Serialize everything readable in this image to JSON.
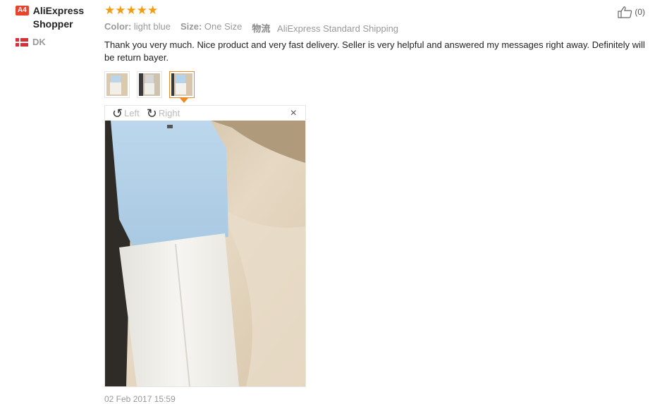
{
  "reviewer": {
    "badge": "A4",
    "name": "AliExpress Shopper",
    "country": "DK"
  },
  "rating": {
    "stars": 5,
    "display": "★★★★★"
  },
  "attributes": {
    "color_label": "Color:",
    "color_value": "light blue",
    "size_label": "Size:",
    "size_value": "One Size",
    "shipping_icon": "物流",
    "shipping_value": "AliExpress Standard Shipping"
  },
  "feedback": "Thank you very much. Nice product and very fast delivery. Seller is very helpful and answered my messages right away. Definitely will be return bayer.",
  "thumbnails": [
    {
      "name": "thumb-1",
      "active": false
    },
    {
      "name": "thumb-2",
      "active": false
    },
    {
      "name": "thumb-3",
      "active": true
    }
  ],
  "viewer": {
    "rotate_left_label": "Left",
    "rotate_right_label": "Right",
    "close_label": "×"
  },
  "like": {
    "count_text": "(0)"
  },
  "timestamp": "02 Feb 2017 15:59",
  "colors": {
    "accent": "#f08a24",
    "stars": "#f39c12",
    "badge": "#e8442d"
  }
}
